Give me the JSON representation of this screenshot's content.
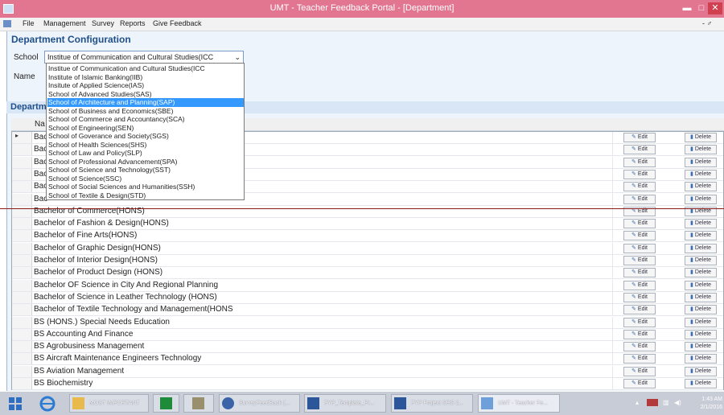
{
  "window": {
    "title": "UMT - Teacher Feedback Portal - [Department]",
    "controls": {
      "minimize": "▬",
      "maximize": "□",
      "close": "✕"
    }
  },
  "menubar": {
    "items": [
      "File",
      "Management",
      "Survey",
      "Reports",
      "Give Feedback"
    ],
    "right_controls": "- ♂"
  },
  "config": {
    "title": "Department Configuration",
    "school_label": "School",
    "school_value": "Institue of Communication and Cultural Studies(ICC",
    "name_label": "Name"
  },
  "grid": {
    "title": "Departm",
    "column_name": "Na",
    "edit_label": "Edit",
    "delete_label": "Delete",
    "row_indicator": "▸",
    "rows": [
      "Bac",
      "Bac",
      "Bac",
      "Bac",
      "Bac",
      "Bac",
      "Bachelor of Commerce(HONS)",
      "Bachelor of Fashion & Design(HONS)",
      "Bachelor of Fine Arts(HONS)",
      "Bachelor of Graphic Design(HONS)",
      "Bachelor of Interior Design(HONS)",
      "Bachelor of Product Design (HONS)",
      "Bachelor OF Science in City And Regional Planning",
      "Bachelor of Science in Leather Technology (HONS)",
      "Bachelor of Textile Technology and Management(HONS",
      "BS (HONS.) Special Needs Education",
      "BS Accounting And Finance",
      "BS Agrobusiness Management",
      "BS Aircraft Maintenance Engineers Technology",
      "BS Aviation Management",
      "BS Biochemistry"
    ]
  },
  "dropdown": {
    "selected_index": 4,
    "options": [
      "Institue of Communication and Cultural Studies(ICC",
      "Institute of Islamic Banking(IIB)",
      "Insitute of Applied Science(IAS)",
      "School of Advanced Studies(SAS)",
      "School of Architecture and Planning(SAP)",
      "School of Business and Economics(SBE)",
      "School of Commerce and Accountancy(SCA)",
      "School of Engineering(SEN)",
      "School of Goverance and Society(SGS)",
      "School of Health Sciences(SHS)",
      "School of Law and Policy(SLP)",
      "School of Professional Advancement(SPA)",
      "School of Science and Technology(SST)",
      "School of Science(SSC)",
      "School of Social Sciences and Humanities(SSH)",
      "School of Textile & Design(STD)"
    ]
  },
  "taskbar": {
    "items": [
      "MOST IMPORTANT",
      "",
      "",
      "SurveyFeedBack (...",
      "FYP_Template_Pr...",
      "FYP Project SRS 2...",
      "UMT - Teacher Fe..."
    ],
    "time": "1:43 AM",
    "date": "2/1/2016"
  },
  "colors": {
    "titlebar": "#e2758f",
    "accent_blue": "#1f4f8b",
    "selection": "#3399ff",
    "window_bg": "#eef4fb"
  }
}
